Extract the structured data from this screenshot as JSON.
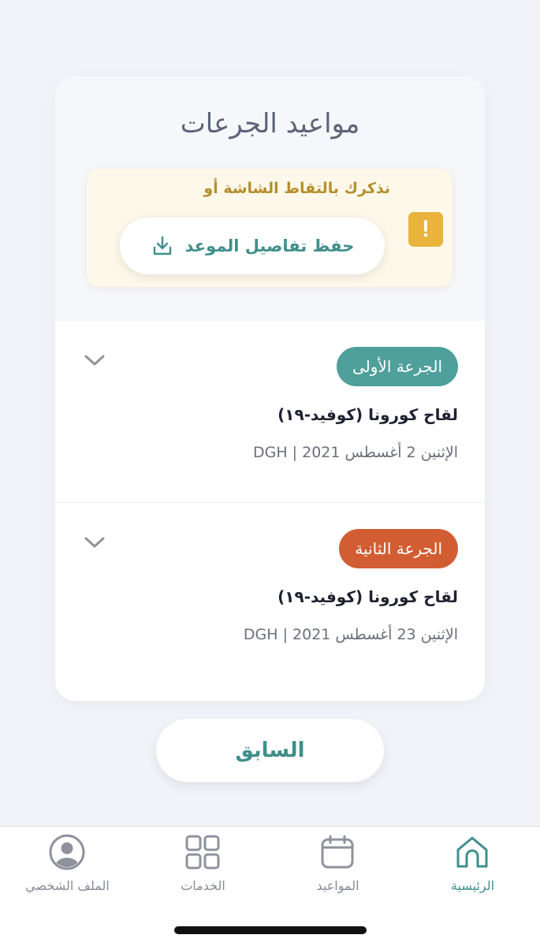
{
  "colors": {
    "accent": "#3f8f8c",
    "first_dose": "#4f9f9b",
    "second_dose": "#d35d33",
    "warning": "#e9b33c",
    "warning_text": "#b48f2e"
  },
  "title": "مواعيد الجرعات",
  "notice": {
    "icon": "exclamation-icon",
    "text": "نذكرك بالتقاط الشاشة أو",
    "save_label": "حفظ تفاصيل الموعد",
    "save_icon": "download-icon"
  },
  "doses": [
    {
      "badge": "الجرعة الأولى",
      "vaccine": "لقاح كورونا (كوفيد-١٩)",
      "date_line": "الإثنين 2 أغسطس 2021 | DGH"
    },
    {
      "badge": "الجرعة الثانية",
      "vaccine": "لقاح كورونا (كوفيد-١٩)",
      "date_line": "الإثنين 23 أغسطس 2021 | DGH"
    }
  ],
  "previous_label": "السابق",
  "tabs": [
    {
      "label": "الرئيسية",
      "icon": "home-icon",
      "active": true
    },
    {
      "label": "المواعيد",
      "icon": "calendar-icon",
      "active": false
    },
    {
      "label": "الخدمات",
      "icon": "grid-icon",
      "active": false
    },
    {
      "label": "الملف الشخصي",
      "icon": "profile-icon",
      "active": false
    }
  ]
}
